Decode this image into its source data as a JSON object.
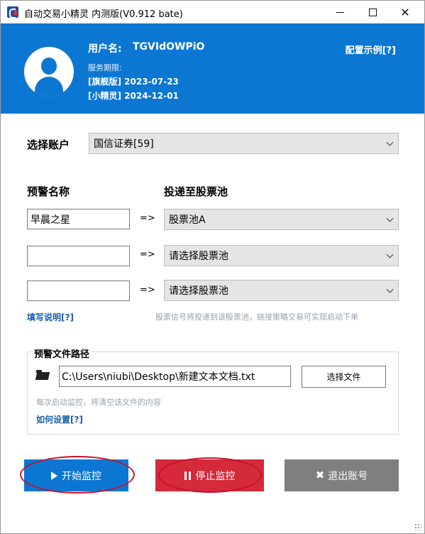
{
  "window": {
    "title": "自动交易小精灵 内测版(V0.912 bate)"
  },
  "header": {
    "user_label": "用户名:",
    "user_name": "TGVIdOWPiO",
    "service_label": "服务期限:",
    "service_lines": [
      "[旗舰版] 2023-07-23",
      "[小精灵] 2024-12-01"
    ],
    "config_link": "配置示例[?]"
  },
  "account": {
    "label": "选择账户",
    "selected": "国信证券[59]"
  },
  "alerts": {
    "name_header": "预警名称",
    "pool_header": "投递至股票池",
    "arrow": "=>",
    "rows": [
      {
        "name": "早晨之星",
        "pool": "股票池A"
      },
      {
        "name": "",
        "pool": "请选择股票池"
      },
      {
        "name": "",
        "pool": "请选择股票池"
      }
    ],
    "help_link": "填写说明[?]",
    "hint": "股票信号将投递到该股票池，链接策略交易可实现启动下单"
  },
  "file": {
    "group_title": "预警文件路径",
    "path": "C:\\Users\\niubi\\Desktop\\新建文本文档.txt",
    "choose_button": "选择文件",
    "note": "每次启动监控，将清空该文件的内容",
    "howto_link": "如何设置[?]"
  },
  "actions": {
    "start": "开始监控",
    "stop": "停止监控",
    "logout": "退出账号"
  },
  "colors": {
    "header_blue": "#0b77d3",
    "stop_red": "#d42a3a",
    "logout_gray": "#7f7f7f",
    "link_blue": "#1a5fa8",
    "annotation_red": "#c8102e"
  }
}
